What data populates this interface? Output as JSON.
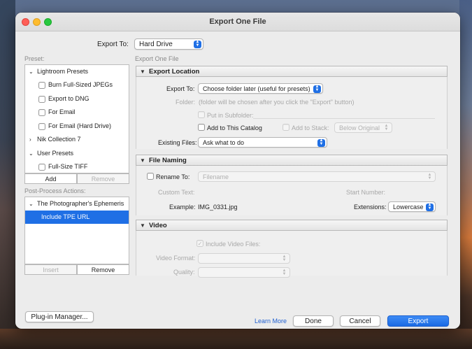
{
  "window": {
    "title": "Export One File"
  },
  "export_to": {
    "label": "Export To:",
    "value": "Hard Drive"
  },
  "preset_panel": {
    "heading": "Preset:",
    "groups": [
      {
        "name": "Lightroom Presets",
        "items": [
          "Burn Full-Sized JPEGs",
          "Export to DNG",
          "For Email",
          "For Email (Hard Drive)"
        ]
      },
      {
        "name": "Nik Collection 7",
        "items": []
      },
      {
        "name": "User Presets",
        "items": [
          "Full-Size TIFF"
        ]
      }
    ],
    "add_label": "Add",
    "remove_label": "Remove"
  },
  "post_process": {
    "heading": "Post-Process Actions:",
    "group": "The Photographer's Ephemeris",
    "item": "Include TPE URL",
    "insert_label": "Insert",
    "remove_label": "Remove"
  },
  "main_heading": "Export One File",
  "export_location": {
    "title": "Export Location",
    "export_to_label": "Export To:",
    "export_to_value": "Choose folder later (useful for presets)",
    "folder_label": "Folder:",
    "folder_note": "(folder will be chosen after you click the \"Export\" button)",
    "subfolder_label": "Put in Subfolder:",
    "add_catalog_label": "Add to This Catalog",
    "add_stack_label": "Add to Stack:",
    "stack_value": "Below Original",
    "existing_label": "Existing Files:",
    "existing_value": "Ask what to do"
  },
  "file_naming": {
    "title": "File Naming",
    "rename_label": "Rename To:",
    "rename_value": "Filename",
    "custom_text_label": "Custom Text:",
    "start_number_label": "Start Number:",
    "example_label": "Example:",
    "example_value": "IMG_0331.jpg",
    "extensions_label": "Extensions:",
    "extensions_value": "Lowercase"
  },
  "video": {
    "title": "Video",
    "include_label": "Include Video Files:",
    "format_label": "Video Format:",
    "quality_label": "Quality:"
  },
  "footer": {
    "plugin_manager": "Plug-in Manager...",
    "learn_more": "Learn More",
    "done": "Done",
    "cancel": "Cancel",
    "export": "Export"
  },
  "colors": {
    "accent": "#1f6fe5",
    "window_bg": "#ececec"
  }
}
